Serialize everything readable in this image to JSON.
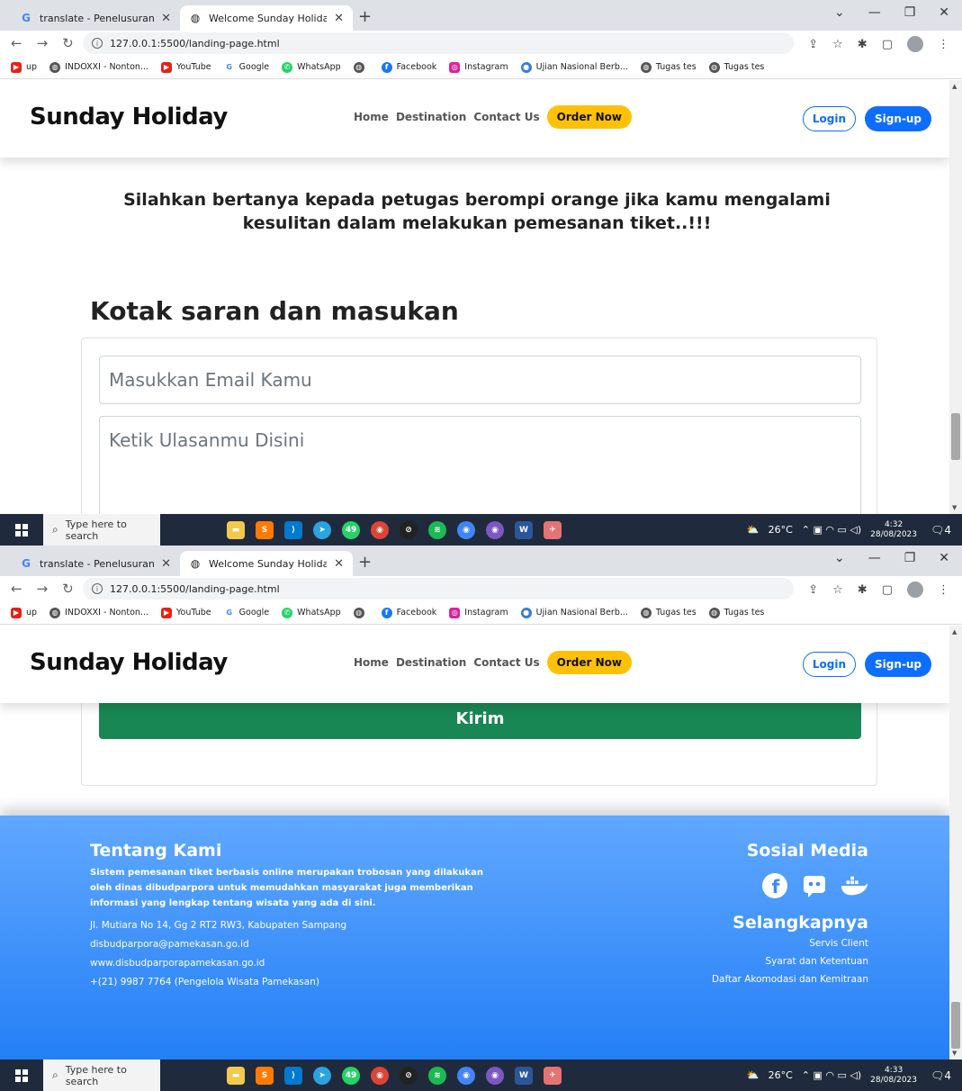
{
  "browser": {
    "tabs": [
      {
        "label": "translate - Penelusuran Google",
        "icon": "google-icon"
      },
      {
        "label": "Welcome Sunday Holiday",
        "icon": "globe-icon"
      }
    ],
    "url": "127.0.0.1:5500/landing-page.html",
    "bookmarks": [
      "up",
      "INDOXXI - Nonton...",
      "YouTube",
      "Google",
      "WhatsApp",
      "",
      "Facebook",
      "Instagram",
      "Ujian Nasional Berb...",
      "Tugas tes",
      "Tugas tes"
    ]
  },
  "site": {
    "brand": "Sunday Holiday",
    "menu": {
      "home": "Home",
      "destination": "Destination",
      "contact": "Contact Us",
      "order": "Order Now"
    },
    "auth": {
      "login": "Login",
      "signup": "Sign-up"
    },
    "notice": "Silahkan bertanya kepada petugas berompi orange jika kamu mengalami kesulitan dalam melakukan pemesanan tiket..!!!",
    "form": {
      "title": "Kotak saran dan masukan",
      "email_placeholder": "Masukkan Email Kamu",
      "review_placeholder": "Ketik Ulasanmu Disini",
      "submit": "Kirim"
    },
    "footer": {
      "about_title": "Tentang Kami",
      "about_text": "Sistem pemesanan tiket berbasis online merupakan trobosan yang dilakukan oleh dinas dibudparpora untuk memudahkan masyarakat juga memberikan informasi yang lengkap tentang wisata yang ada di sini.",
      "address": "Jl. Mutiara No 14, Gg 2 RT2 RW3, Kabupaten Sampang",
      "email": "disbudparpora@pamekasan.go.id",
      "website": "www.disbudparporapamekasan.go.id",
      "phone": "+(21) 9987 7764 (Pengelola Wisata Pamekasan)",
      "social_title": "Sosial Media",
      "social_icons": [
        "facebook-icon",
        "discord-icon",
        "docker-icon"
      ],
      "more_title": "Selangkapnya",
      "links": [
        "Servis Client",
        "Syarat dan Ketentuan",
        "Daftar Akomodasi dan Kemitraan"
      ]
    }
  },
  "taskbar": {
    "search_placeholder": "Type here to search",
    "weather": "26°C",
    "whatsapp_badge": "49",
    "clock1": {
      "time": "4:32",
      "date": "28/08/2023"
    },
    "clock2": {
      "time": "4:33",
      "date": "28/08/2023"
    },
    "notif_count": "4"
  },
  "colors": {
    "accent": "#0d6efd",
    "order": "#ffc107",
    "submit": "#198754",
    "footer_top": "#60a8ff",
    "footer_bottom": "#1e7bf5"
  }
}
